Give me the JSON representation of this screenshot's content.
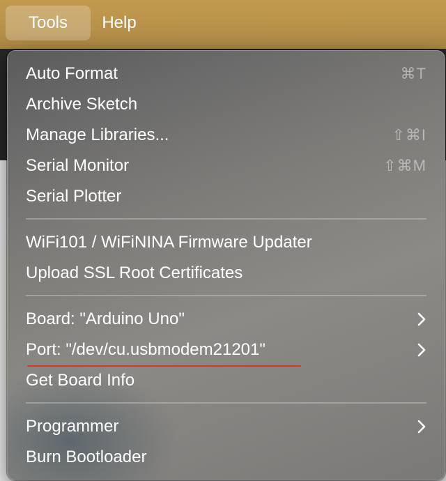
{
  "menubar": {
    "items": [
      {
        "label": "Tools"
      },
      {
        "label": "Help"
      }
    ]
  },
  "menu": {
    "groups": [
      {
        "items": [
          {
            "label": "Auto Format",
            "shortcut": "⌘T"
          },
          {
            "label": "Archive Sketch",
            "shortcut": ""
          },
          {
            "label": "Manage Libraries...",
            "shortcut": "⇧⌘I"
          },
          {
            "label": "Serial Monitor",
            "shortcut": "⇧⌘M"
          },
          {
            "label": "Serial Plotter",
            "shortcut": ""
          }
        ]
      },
      {
        "items": [
          {
            "label": "WiFi101 / WiFiNINA Firmware Updater"
          },
          {
            "label": "Upload SSL Root Certificates"
          }
        ]
      },
      {
        "items": [
          {
            "label": "Board: \"Arduino Uno\"",
            "submenu": true
          },
          {
            "label": "Port: \"/dev/cu.usbmodem21201\"",
            "submenu": true,
            "annotated": true
          },
          {
            "label": "Get Board Info"
          }
        ]
      },
      {
        "items": [
          {
            "label": "Programmer",
            "submenu": true
          },
          {
            "label": "Burn Bootloader"
          }
        ]
      }
    ],
    "annotation_color": "#d9381e"
  },
  "icons": {
    "submenu": "chevron-right-icon"
  }
}
